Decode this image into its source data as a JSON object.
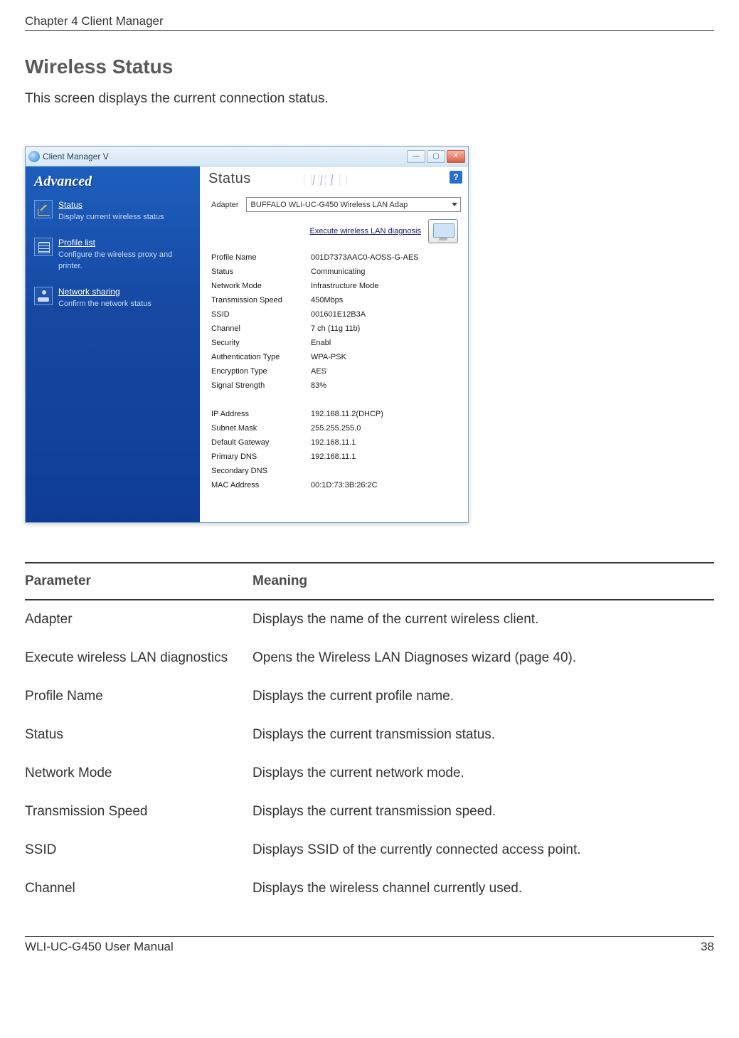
{
  "header": {
    "chapter": "Chapter 4  Client Manager"
  },
  "section": {
    "title": "Wireless Status",
    "description": "This screen displays the current connection status."
  },
  "app": {
    "title": "Client Manager V",
    "sidebar_title": "Advanced",
    "help_label": "?",
    "win_min": "—",
    "win_max": "▢",
    "win_close": "✕",
    "nav": [
      {
        "link": "Status",
        "desc": "Display current wireless status"
      },
      {
        "link": "Profile list",
        "desc": "Configure the wireless proxy and printer."
      },
      {
        "link": "Network sharing",
        "desc": "Confirm the network status"
      }
    ],
    "content": {
      "heading": "Status",
      "adapter_label": "Adapter",
      "adapter_value": "BUFFALO WLI-UC-G450 Wireless LAN Adap",
      "diagnosis_link": "Execute wireless LAN diagnosis",
      "group1": [
        {
          "k": "Profile Name",
          "v": "001D7373AAC0-AOSS-G-AES"
        },
        {
          "k": "Status",
          "v": "Communicating"
        },
        {
          "k": "Network Mode",
          "v": "Infrastructure Mode"
        },
        {
          "k": "Transmission Speed",
          "v": "450Mbps"
        },
        {
          "k": "SSID",
          "v": "001601E12B3A"
        },
        {
          "k": "Channel",
          "v": "7 ch (11g 11b)"
        },
        {
          "k": "Security",
          "v": "Enabl"
        },
        {
          "k": "Authentication Type",
          "v": "WPA-PSK"
        },
        {
          "k": "Encryption Type",
          "v": "AES"
        },
        {
          "k": "Signal Strength",
          "v": "83%"
        }
      ],
      "group2": [
        {
          "k": "IP Address",
          "v": "192.168.11.2(DHCP)"
        },
        {
          "k": "Subnet Mask",
          "v": "255.255.255.0"
        },
        {
          "k": "Default Gateway",
          "v": "192.168.11.1"
        },
        {
          "k": "Primary DNS",
          "v": "192.168.11.1"
        },
        {
          "k": "Secondary DNS",
          "v": ""
        },
        {
          "k": "MAC Address",
          "v": "00:1D:73:3B:26:2C"
        }
      ]
    }
  },
  "param_table": {
    "header": {
      "param": "Parameter",
      "meaning": "Meaning"
    },
    "rows": [
      {
        "param": "Adapter",
        "meaning": "Displays the name of the current wireless client."
      },
      {
        "param": "Execute wireless LAN diagnostics",
        "meaning": "Opens the Wireless LAN Diagnoses wizard (page 40)."
      },
      {
        "param": "Profile Name",
        "meaning": "Displays the current profile name."
      },
      {
        "param": "Status",
        "meaning": "Displays the current transmission status."
      },
      {
        "param": "Network Mode",
        "meaning": "Displays the current network mode."
      },
      {
        "param": "Transmission Speed",
        "meaning": "Displays the current transmission speed."
      },
      {
        "param": "SSID",
        "meaning": "Displays SSID of the currently connected access point."
      },
      {
        "param": "Channel",
        "meaning": "Displays the wireless channel currently used."
      }
    ]
  },
  "footer": {
    "manual": "WLI-UC-G450 User Manual",
    "page": "38"
  }
}
